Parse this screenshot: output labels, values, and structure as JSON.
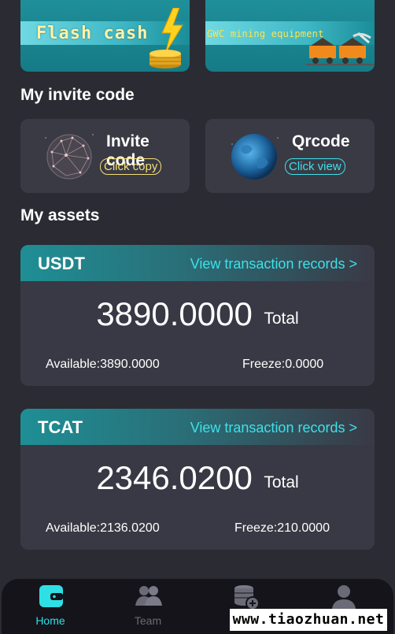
{
  "banners": {
    "flash_cash": "Flash cash",
    "gwc_mining": "GWC mining equipment"
  },
  "invite_section": {
    "title": "My invite code",
    "invite_card": {
      "title": "Invite code",
      "action": "Click copy"
    },
    "qrcode_card": {
      "title": "Qrcode",
      "action": "Click view"
    }
  },
  "assets_section": {
    "title": "My assets",
    "assets": [
      {
        "name": "USDT",
        "link": "View transaction records >",
        "amount": "3890.0000",
        "total_label": "Total",
        "available": "Available:3890.0000",
        "freeze": "Freeze:0.0000"
      },
      {
        "name": "TCAT",
        "link": "View transaction records >",
        "amount": "2346.0200",
        "total_label": "Total",
        "available": "Available:2136.0200",
        "freeze": "Freeze:210.0000"
      }
    ]
  },
  "tabbar": {
    "tabs": [
      {
        "label": "Home",
        "icon": "wallet-icon",
        "active": true
      },
      {
        "label": "Team",
        "icon": "team-icon",
        "active": false
      },
      {
        "label": "",
        "icon": "coins-plus-icon",
        "active": false
      },
      {
        "label": "",
        "icon": "user-icon",
        "active": false
      }
    ]
  },
  "watermark": "www.tiaozhuan.net",
  "colors": {
    "background": "#2b2b33",
    "card": "#3a3a45",
    "accent_cyan": "#3ee0e8",
    "accent_yellow": "#f5df77",
    "tab_active": "#2ee0e6",
    "tab_inactive": "#6b6b78"
  }
}
